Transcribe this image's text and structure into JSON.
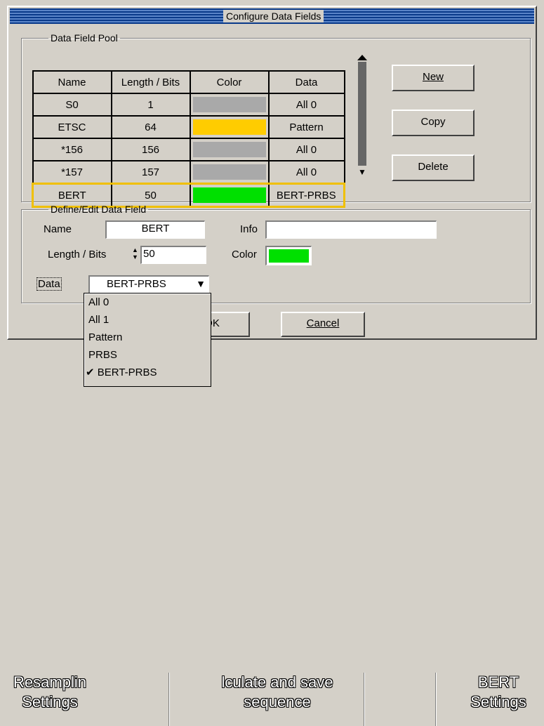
{
  "window_title": "Configure Data Fields",
  "pool": {
    "legend": "Data Field Pool",
    "headers": [
      "Name",
      "Length / Bits",
      "Color",
      "Data"
    ],
    "rows": [
      {
        "name": "S0",
        "length": "1",
        "color": "#a9a9a9",
        "data": "All 0"
      },
      {
        "name": "ETSC",
        "length": "64",
        "color": "#ffcc00",
        "data": "Pattern"
      },
      {
        "name": "*156",
        "length": "156",
        "color": "#a9a9a9",
        "data": "All 0"
      },
      {
        "name": "*157",
        "length": "157",
        "color": "#a9a9a9",
        "data": "All 0"
      },
      {
        "name": "BERT",
        "length": "50",
        "color": "#00e000",
        "data": "BERT-PRBS"
      }
    ],
    "selected_index": 4
  },
  "buttons": {
    "new": "New",
    "copy": "Copy",
    "delete": "Delete",
    "ok": "OK",
    "cancel": "Cancel"
  },
  "edit": {
    "legend": "Define/Edit Data Field",
    "name_label": "Name",
    "name_value": "BERT",
    "info_label": "Info",
    "info_value": "",
    "length_label": "Length / Bits",
    "length_value": "50",
    "color_label": "Color",
    "color_value": "#00e000",
    "data_label": "Data",
    "data_value": "BERT-PRBS"
  },
  "dropdown": {
    "options": [
      "All 0",
      "All 1",
      "Pattern",
      "PRBS",
      "BERT-PRBS"
    ],
    "checked": "BERT-PRBS",
    "check_mark": "✔"
  },
  "background": {
    "btn1_line1": "Resamplin",
    "btn1_line2": "Settings",
    "btn2_line1": "lculate and save",
    "btn2_line2": "sequence",
    "btn3_line1": "BERT",
    "btn3_line2": "Settings"
  }
}
